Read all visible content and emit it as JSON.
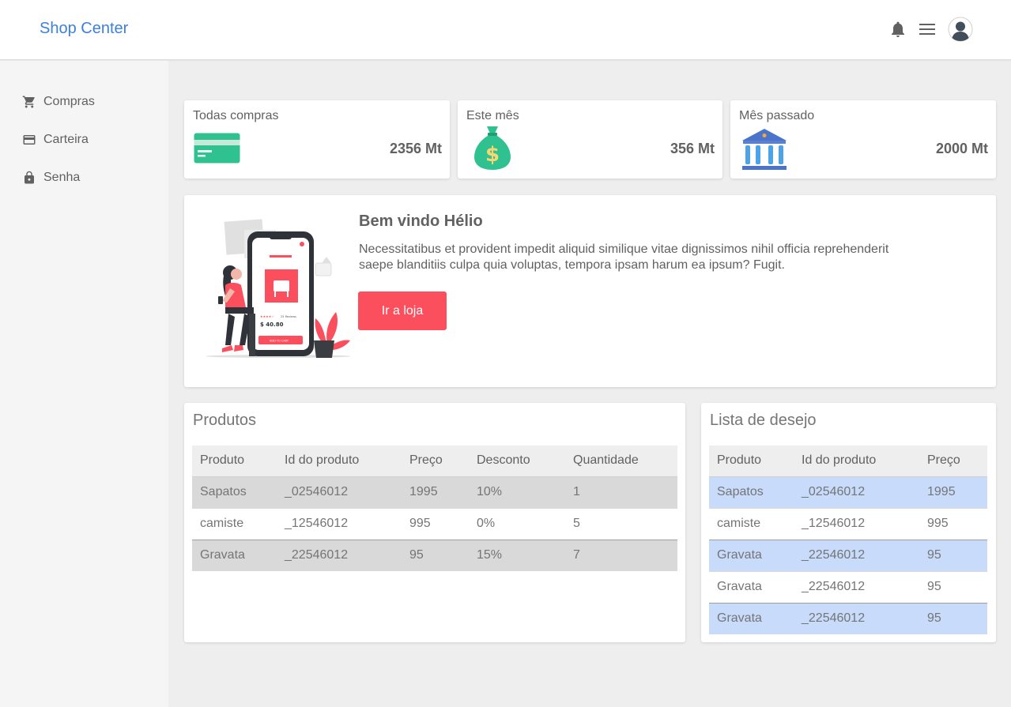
{
  "header": {
    "brand": "Shop Center"
  },
  "sidebar": {
    "items": [
      {
        "label": "Compras",
        "icon": "cart-icon"
      },
      {
        "label": "Carteira",
        "icon": "credit-card-icon"
      },
      {
        "label": "Senha",
        "icon": "lock-icon"
      }
    ]
  },
  "stats": [
    {
      "title": "Todas compras",
      "value": "2356 Mt",
      "icon": "credit-card-icon"
    },
    {
      "title": "Este mês",
      "value": "356 Mt",
      "icon": "money-bag-icon"
    },
    {
      "title": "Mês passado",
      "value": "2000 Mt",
      "icon": "bank-icon"
    }
  ],
  "welcome": {
    "title": "Bem vindo Hélio",
    "text": "Necessitatibus et provident impedit aliquid similique vitae dignissimos nihil officia reprehenderit saepe blanditiis culpa quia voluptas, tempora ipsam harum ea ipsum? Fugit.",
    "button": "Ir a loja",
    "illustration": {
      "price": "$ 40.80",
      "reviews": "25 Reviews",
      "cart_button": "ADD TO CART"
    }
  },
  "products": {
    "title": "Produtos",
    "columns": [
      "Produto",
      "Id do produto",
      "Preço",
      "Desconto",
      "Quantidade"
    ],
    "rows": [
      [
        "Sapatos",
        "_02546012",
        "1995",
        "10%",
        "1"
      ],
      [
        "camiste",
        "_12546012",
        "995",
        "0%",
        "5"
      ],
      [
        "Gravata",
        "_22546012",
        "95",
        "15%",
        "7"
      ]
    ]
  },
  "wishlist": {
    "title": "Lista de desejo",
    "columns": [
      "Produto",
      "Id do produto",
      "Preço"
    ],
    "rows": [
      [
        "Sapatos",
        "_02546012",
        "1995"
      ],
      [
        "camiste",
        "_12546012",
        "995"
      ],
      [
        "Gravata",
        "_22546012",
        "95"
      ],
      [
        "Gravata",
        "_22546012",
        "95"
      ],
      [
        "Gravata",
        "_22546012",
        "95"
      ]
    ]
  },
  "colors": {
    "brand": "#3d7fe0",
    "button": "#fb4f5e",
    "row_gray": "#d9d9d9",
    "row_blue": "#c8dbfb"
  }
}
